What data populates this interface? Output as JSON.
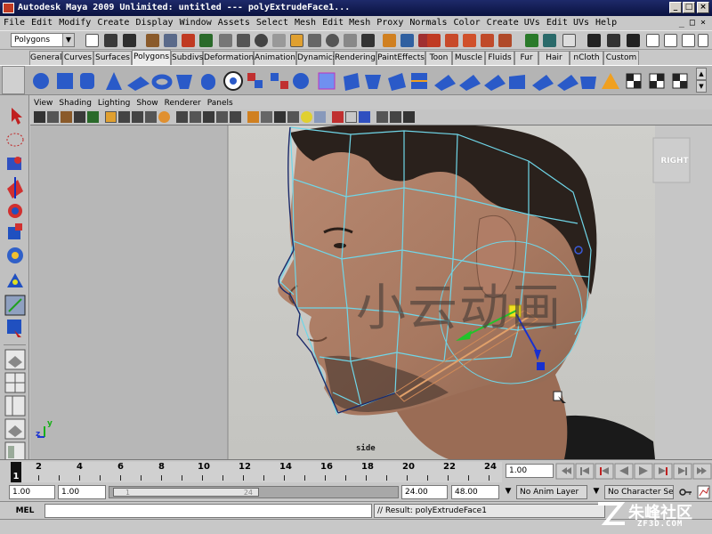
{
  "window": {
    "title": "Autodesk Maya 2009 Unlimited: untitled   ---   polyExtrudeFace1...",
    "minimize_glyph": "_",
    "maximize_glyph": "□",
    "close_glyph": "×"
  },
  "menubar": {
    "items": [
      "File",
      "Edit",
      "Modify",
      "Create",
      "Display",
      "Window",
      "Assets",
      "Select",
      "Mesh",
      "Edit Mesh",
      "Proxy",
      "Normals",
      "Color",
      "Create UVs",
      "Edit UVs",
      "Help"
    ],
    "right_glyphs": "_ □ ×"
  },
  "statusline": {
    "mode": "Polygons",
    "dropdown_glyph": "▼"
  },
  "shelf": {
    "tabs": [
      "General",
      "Curves",
      "Surfaces",
      "Polygons",
      "Subdivs",
      "Deformation",
      "Animation",
      "Dynamics",
      "Rendering",
      "PaintEffects",
      "Toon",
      "Muscle",
      "Fluids",
      "Fur",
      "Hair",
      "nCloth",
      "Custom"
    ],
    "active_tab": "Polygons"
  },
  "panel": {
    "menus": [
      "View",
      "Shading",
      "Lighting",
      "Show",
      "Renderer",
      "Panels"
    ],
    "camera_label": "side",
    "view_cube_label": "RIGHT",
    "axis_y": "y",
    "axis_z": "z"
  },
  "overlay": {
    "watermark_text": "小云动画",
    "site_logo_text": "朱峰社区",
    "site_logo_sub": "ZF3D.COM"
  },
  "timeslider": {
    "ticks": [
      "2",
      "4",
      "6",
      "8",
      "10",
      "12",
      "14",
      "16",
      "18",
      "20",
      "22",
      "24"
    ],
    "current_frame": "1",
    "current_frame_field": "1.00"
  },
  "rangeslider": {
    "start_time": "1.00",
    "playback_start": "1.00",
    "range_bar_start": "1",
    "range_bar_end": "24",
    "playback_end": "24.00",
    "end_time": "48.00",
    "anim_layer": "No Anim Layer",
    "character_set": "No Character Set"
  },
  "commandline": {
    "label": "MEL",
    "input_value": "",
    "result": "// Result: polyExtrudeFace1"
  },
  "colors": {
    "titlebar": "#0a1240",
    "wire": "#6fd6e8",
    "manip_green": "#22c32b",
    "manip_blue": "#1830d0",
    "manip_yellow": "#f0e020"
  }
}
